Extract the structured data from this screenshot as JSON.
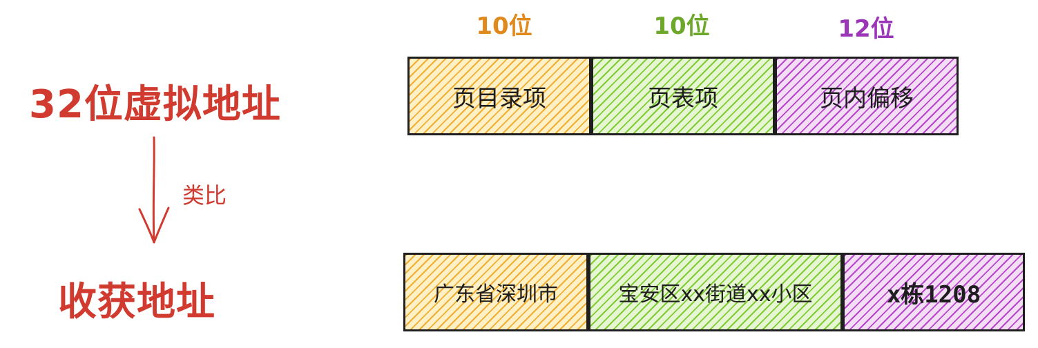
{
  "left": {
    "top_title": "32位虚拟地址",
    "arrow_label": "类比",
    "bottom_title": "收获地址"
  },
  "bit_labels": [
    {
      "text": "10位",
      "color": "#e08a1e"
    },
    {
      "text": "10位",
      "color": "#6ea82a"
    },
    {
      "text": "12位",
      "color": "#9b36b8"
    }
  ],
  "top_row": [
    "页目录项",
    "页表项",
    "页内偏移"
  ],
  "bottom_row": [
    "广东省深圳市",
    "宝安区xx街道xx小区",
    "x栋1208"
  ],
  "colors": {
    "title_red": "#d13a2f",
    "orange": "#f0aa28",
    "green": "#78c828",
    "purple": "#b43cc8"
  }
}
